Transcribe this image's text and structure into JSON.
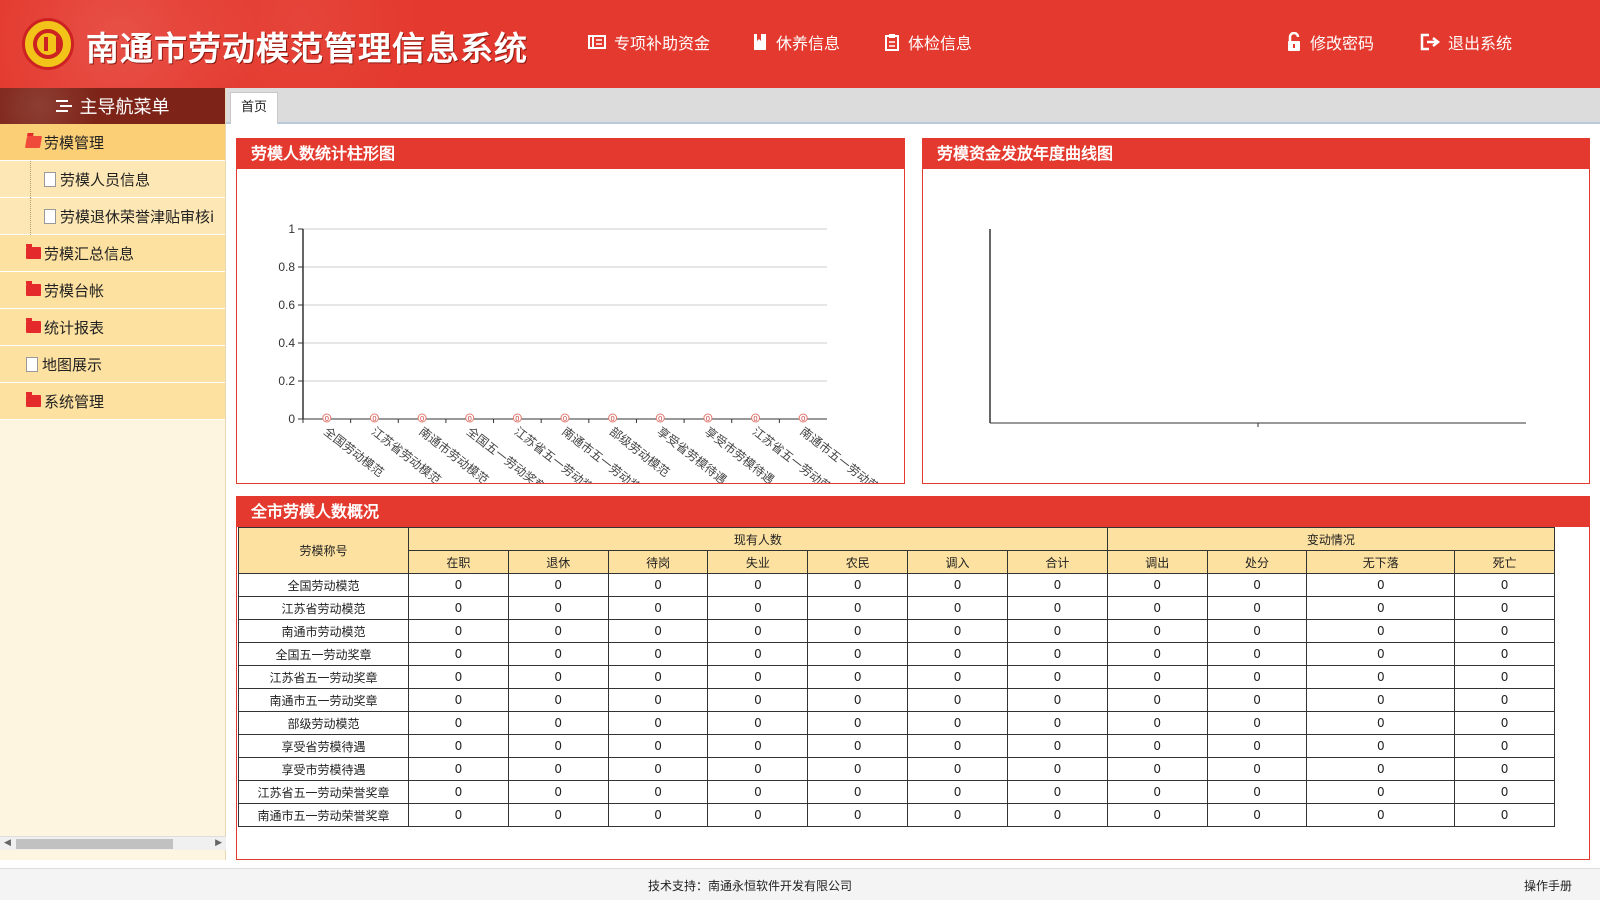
{
  "header": {
    "title": "南通市劳动模范管理信息系统",
    "nav": [
      {
        "label": "专项补助资金",
        "icon": "book-icon"
      },
      {
        "label": "休养信息",
        "icon": "bookmark-icon"
      },
      {
        "label": "体检信息",
        "icon": "clipboard-icon"
      },
      {
        "label": "修改密码",
        "icon": "lock-icon"
      },
      {
        "label": "退出系统",
        "icon": "logout-icon"
      }
    ]
  },
  "sidebar": {
    "title": "主导航菜单",
    "items": [
      {
        "label": "劳模管理",
        "icon": "folder-open-icon"
      },
      {
        "label": "劳模人员信息",
        "icon": "document-icon"
      },
      {
        "label": "劳模退休荣誉津贴审核i",
        "icon": "document-icon"
      },
      {
        "label": "劳模汇总信息",
        "icon": "folder-icon"
      },
      {
        "label": "劳模台帐",
        "icon": "folder-icon"
      },
      {
        "label": "统计报表",
        "icon": "folder-icon"
      },
      {
        "label": "地图展示",
        "icon": "document-icon"
      },
      {
        "label": "系统管理",
        "icon": "folder-icon"
      }
    ]
  },
  "tabs": [
    {
      "label": "首页"
    }
  ],
  "bar_panel": {
    "title": "劳模人数统计柱形图"
  },
  "line_panel": {
    "title": "劳模资金发放年度曲线图"
  },
  "chart_data": [
    {
      "type": "bar",
      "title": "劳模人数统计柱形图",
      "categories": [
        "全国劳动模范",
        "江苏省劳动模范",
        "南通市劳动模范",
        "全国五一劳动奖章",
        "江苏省五一劳动奖章",
        "南通市五一劳动奖章",
        "部级劳动模范",
        "享受省劳模待遇",
        "享受市劳模待遇",
        "江苏省五一劳动荣誉奖章",
        "南通市五一劳动荣誉奖章"
      ],
      "categories_visible": [
        "全国劳动模范",
        "江苏省劳动模范",
        "南通市劳动模范",
        "全国五一劳动奖章",
        "江苏省五一劳动奖章",
        "南通市五一劳动奖章",
        "部级劳动模范",
        "享受省劳模待遇",
        "享受市劳模待遇",
        "江苏省五一劳动荣...",
        "南通市五一劳动荣誉..."
      ],
      "values": [
        0,
        0,
        0,
        0,
        0,
        0,
        0,
        0,
        0,
        0,
        0
      ],
      "yticks": [
        "0",
        "0.2",
        "0.4",
        "0.6",
        "0.8",
        "1"
      ],
      "ylim": [
        0,
        1
      ],
      "grid": true
    },
    {
      "type": "line",
      "title": "劳模资金发放年度曲线图",
      "series": [],
      "grid": false
    }
  ],
  "table": {
    "title": "全市劳模人数概况",
    "group_headers": {
      "name": "劳模称号",
      "current": "现有人数",
      "change": "变动情况"
    },
    "columns": [
      "在职",
      "退休",
      "待岗",
      "失业",
      "农民",
      "调入",
      "合计",
      "调出",
      "处分",
      "无下落",
      "死亡"
    ],
    "rows": [
      {
        "name": "全国劳动模范",
        "values": [
          "0",
          "0",
          "0",
          "0",
          "0",
          "0",
          "0",
          "0",
          "0",
          "0",
          "0"
        ]
      },
      {
        "name": "江苏省劳动模范",
        "values": [
          "0",
          "0",
          "0",
          "0",
          "0",
          "0",
          "0",
          "0",
          "0",
          "0",
          "0"
        ]
      },
      {
        "name": "南通市劳动模范",
        "values": [
          "0",
          "0",
          "0",
          "0",
          "0",
          "0",
          "0",
          "0",
          "0",
          "0",
          "0"
        ]
      },
      {
        "name": "全国五一劳动奖章",
        "values": [
          "0",
          "0",
          "0",
          "0",
          "0",
          "0",
          "0",
          "0",
          "0",
          "0",
          "0"
        ]
      },
      {
        "name": "江苏省五一劳动奖章",
        "values": [
          "0",
          "0",
          "0",
          "0",
          "0",
          "0",
          "0",
          "0",
          "0",
          "0",
          "0"
        ]
      },
      {
        "name": "南通市五一劳动奖章",
        "values": [
          "0",
          "0",
          "0",
          "0",
          "0",
          "0",
          "0",
          "0",
          "0",
          "0",
          "0"
        ]
      },
      {
        "name": "部级劳动模范",
        "values": [
          "0",
          "0",
          "0",
          "0",
          "0",
          "0",
          "0",
          "0",
          "0",
          "0",
          "0"
        ]
      },
      {
        "name": "享受省劳模待遇",
        "values": [
          "0",
          "0",
          "0",
          "0",
          "0",
          "0",
          "0",
          "0",
          "0",
          "0",
          "0"
        ]
      },
      {
        "name": "享受市劳模待遇",
        "values": [
          "0",
          "0",
          "0",
          "0",
          "0",
          "0",
          "0",
          "0",
          "0",
          "0",
          "0"
        ]
      },
      {
        "name": "江苏省五一劳动荣誉奖章",
        "values": [
          "0",
          "0",
          "0",
          "0",
          "0",
          "0",
          "0",
          "0",
          "0",
          "0",
          "0"
        ]
      },
      {
        "name": "南通市五一劳动荣誉奖章",
        "values": [
          "0",
          "0",
          "0",
          "0",
          "0",
          "0",
          "0",
          "0",
          "0",
          "0",
          "0"
        ]
      }
    ]
  },
  "footer": {
    "support": "技术支持：南通永恒软件开发有限公司",
    "manual": "操作手册"
  },
  "colors": {
    "primary_red": "#e4392e",
    "menu_yellow": "#fde1a0",
    "menu_active": "#fbcf75"
  }
}
